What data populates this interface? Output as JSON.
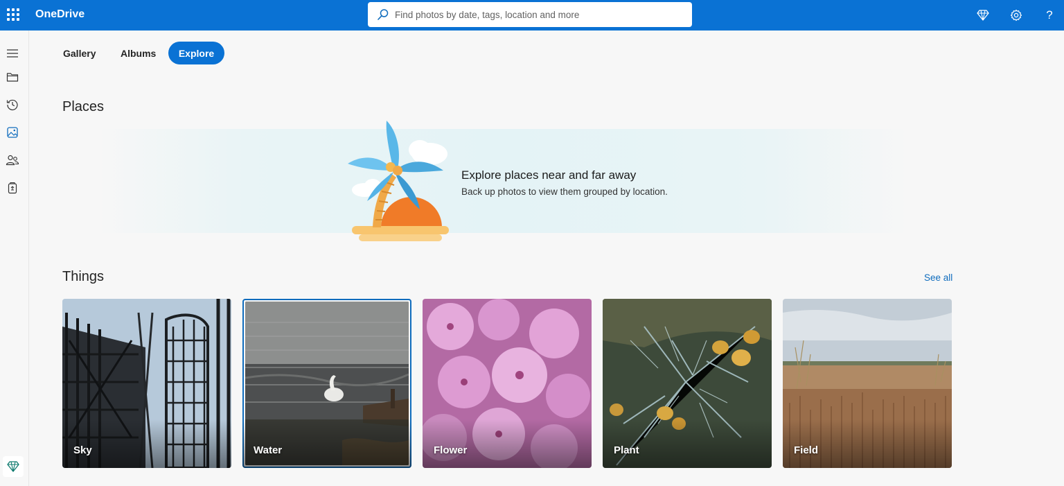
{
  "app": {
    "title": "OneDrive"
  },
  "search": {
    "placeholder": "Find photos by date, tags, location and more"
  },
  "top_icons": [
    "diamond-icon",
    "gear-icon",
    "help-icon"
  ],
  "help_glyph": "?",
  "left_nav": [
    "hamburger-icon",
    "folder-icon",
    "history-icon",
    "photos-icon",
    "people-icon",
    "recycle-bin-icon",
    "premium-diamond-icon"
  ],
  "tabs": [
    {
      "label": "Gallery",
      "active": false
    },
    {
      "label": "Albums",
      "active": false
    },
    {
      "label": "Explore",
      "active": true
    }
  ],
  "places": {
    "title": "Places",
    "heading": "Explore places near and far away",
    "subtext": "Back up photos to view them grouped by location."
  },
  "things": {
    "title": "Things",
    "see_all": "See all",
    "items": [
      {
        "label": "Sky",
        "selected": false
      },
      {
        "label": "Water",
        "selected": true
      },
      {
        "label": "Flower",
        "selected": false
      },
      {
        "label": "Plant",
        "selected": false
      },
      {
        "label": "Field",
        "selected": false
      }
    ]
  },
  "colors": {
    "brand": "#0a72d4",
    "link": "#0f6cbd",
    "background": "#f7f7f7"
  }
}
